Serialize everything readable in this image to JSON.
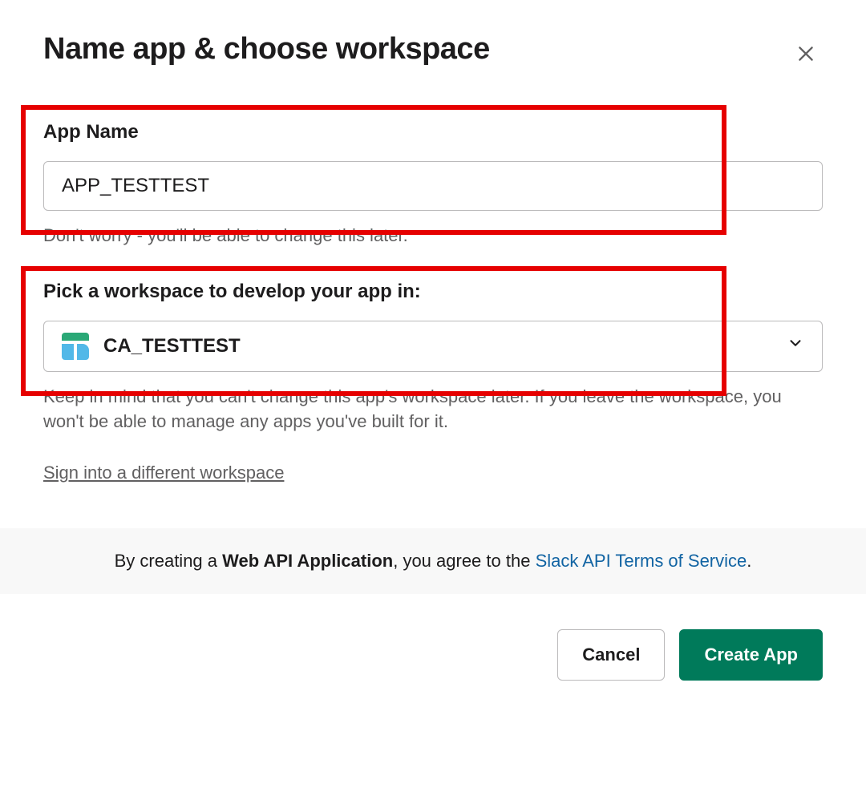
{
  "modal": {
    "title": "Name app & choose workspace"
  },
  "app_name": {
    "label": "App Name",
    "value": "APP_TESTTEST",
    "help": "Don't worry - you'll be able to change this later."
  },
  "workspace": {
    "label": "Pick a workspace to develop your app in:",
    "selected": "CA_TESTTEST",
    "help": "Keep in mind that you can't change this app's workspace later. If you leave the workspace, you won't be able to manage any apps you've built for it.",
    "alt_link": "Sign into a different workspace"
  },
  "terms": {
    "prefix": "By creating a ",
    "bold": "Web API Application",
    "middle": ", you agree to the ",
    "link": "Slack API Terms of Service",
    "suffix": "."
  },
  "actions": {
    "cancel": "Cancel",
    "create": "Create App"
  }
}
